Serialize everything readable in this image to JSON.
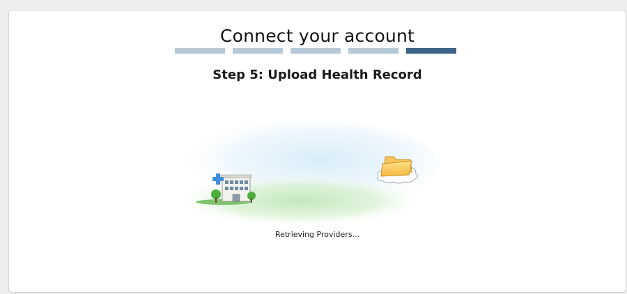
{
  "header": {
    "title": "Connect your account",
    "step_title": "Step 5: Upload Health Record"
  },
  "progress": {
    "total_steps": 5,
    "current_step": 5
  },
  "illustration": {
    "left_icon": "hospital-icon",
    "right_icon": "cloud-folder-icon"
  },
  "status": {
    "text": "Retrieving Providers..."
  },
  "colors": {
    "step_inactive": "#b7c9d6",
    "step_active": "#3a6384"
  }
}
